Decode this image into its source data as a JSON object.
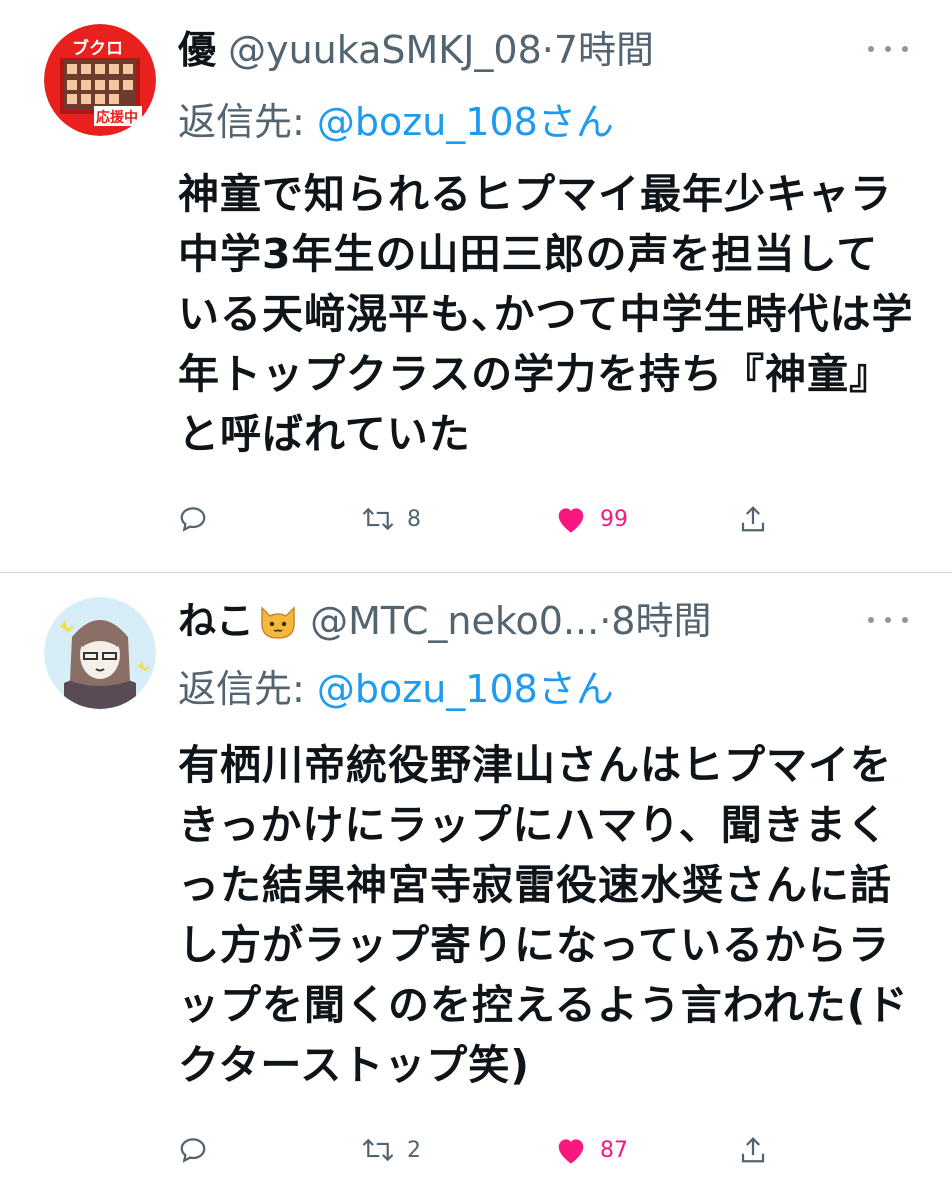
{
  "tweets": [
    {
      "name": "優",
      "handle": "@yuukaSMKJ_08",
      "separator": "·",
      "time": "7時間",
      "reply_prefix": "返信先: ",
      "reply_to": "@bozu_108さん",
      "text": "神童で知られるヒプマイ最年少キャラ中学3年生の山田三郎の声を担当している天﨑滉平も､かつて中学生時代は学年トップクラスの学力を持ち『神童』と呼ばれていた",
      "avatar_badge_top": "ブクロ",
      "avatar_badge_bottom": "応援中",
      "retweets": "8",
      "likes": "99"
    },
    {
      "name": "ねこ",
      "handle": "@MTC_neko0...",
      "separator": "·",
      "time": "8時間",
      "reply_prefix": "返信先: ",
      "reply_to": "@bozu_108さん",
      "text": "有栖川帝統役野津山さんはヒプマイをきっかけにラップにハマり、聞きまくった結果神宮寺寂雷役速水奨さんに話し方がラップ寄りになっているからラップを聞くのを控えるよう言われた(ドクターストップ笑)",
      "retweets": "2",
      "likes": "87"
    }
  ],
  "icons": {
    "reply": "reply-icon",
    "retweet": "retweet-icon",
    "like": "heart-icon",
    "share": "share-icon",
    "more": "more-icon",
    "cat": "cat-emoji"
  },
  "colors": {
    "accent": "#1d9bf0",
    "like": "#f91880",
    "muted": "#536471"
  }
}
